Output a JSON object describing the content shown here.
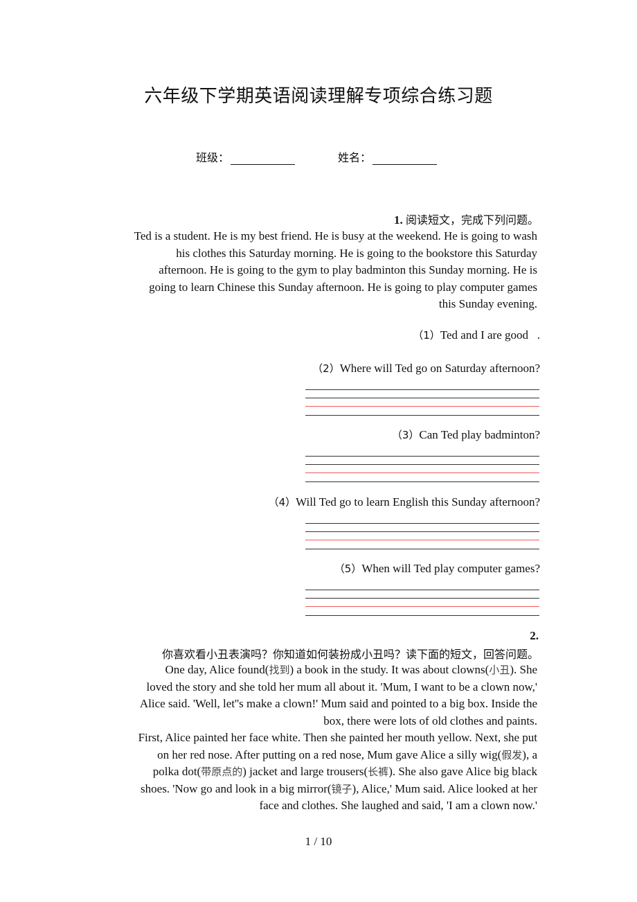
{
  "document": {
    "title": "六年级下学期英语阅读理解专项综合练习题",
    "fields": [
      {
        "label": "班级：",
        "value": ""
      },
      {
        "label": "姓名：",
        "value": ""
      }
    ],
    "page_number": "1 / 10"
  },
  "section1": {
    "number": "1.",
    "instruction": "阅读短文，完成下列问题。",
    "passage_lines": [
      "Ted is a student. He is my best friend. He is busy at the weekend. He is going to wash",
      "his clothes this Saturday morning. He is going to the bookstore this Saturday",
      "afternoon. He is going to the gym to play badminton this Sunday morning. He is",
      "going to learn Chinese this Sunday afternoon. He is going to play computer games",
      "this Sunday evening."
    ],
    "questions": [
      {
        "num": "（1）",
        "text": "Ted and I are good",
        "blank_suffix": "   ."
      },
      {
        "num": "（2）",
        "text": "Where will Ted go on Saturday afternoon?"
      },
      {
        "num": "（3）",
        "text": "Can Ted play badminton?"
      },
      {
        "num": "（4）",
        "text": "Will Ted go to learn English this Sunday afternoon?"
      },
      {
        "num": "（5）",
        "text": "When will Ted play computer games?"
      }
    ],
    "answer_line_colors": {
      "normal": "#333333",
      "guide": "#f25a5a"
    }
  },
  "section2": {
    "number": "2.",
    "instruction": "你喜欢看小丑表演吗？你知道如何装扮成小丑吗？读下面的短文，回答问题。",
    "passage_lines": [
      [
        {
          "t": "One day, Alice found("
        },
        {
          "cn": "找到"
        },
        {
          "t": ") a book in the study. It was about clowns("
        },
        {
          "cn": "小丑"
        },
        {
          "t": "). She"
        }
      ],
      [
        {
          "t": "loved the story and she told her mum all about it. 'Mum, I want to be a clown now,'"
        }
      ],
      [
        {
          "t": "Alice said. 'Well, let''s make a clown!' Mum said and pointed to a big box. Inside the"
        }
      ],
      [
        {
          "t": "box, there were lots of old clothes and paints."
        }
      ],
      [
        {
          "t": "First, Alice painted her face white. Then she painted her mouth yellow. Next, she put"
        }
      ],
      [
        {
          "t": "on her red nose. After putting on a red nose, Mum gave Alice a silly wig("
        },
        {
          "cn": "假发"
        },
        {
          "t": "), a"
        }
      ],
      [
        {
          "t": "polka dot("
        },
        {
          "cn": "带原点的"
        },
        {
          "t": ") jacket and large trousers("
        },
        {
          "cn": "长裤"
        },
        {
          "t": "). She also gave Alice big black"
        }
      ],
      [
        {
          "t": "shoes. 'Now go and look in a big mirror("
        },
        {
          "cn": "镜子"
        },
        {
          "t": "), Alice,' Mum said. Alice looked at her"
        }
      ],
      [
        {
          "t": "face and clothes. She laughed and said, 'I am a clown now.'"
        }
      ]
    ]
  }
}
